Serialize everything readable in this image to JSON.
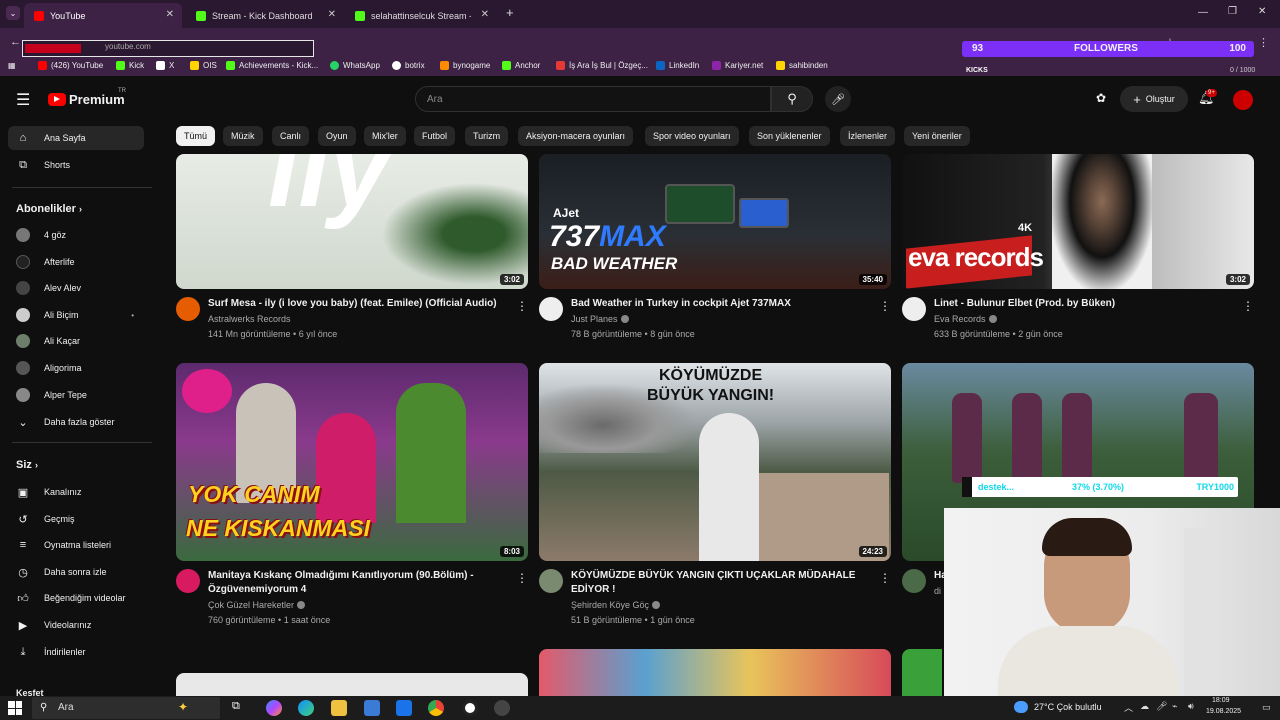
{
  "browser": {
    "tabs": [
      {
        "title": "YouTube",
        "active": true,
        "color": "#ff0000"
      },
      {
        "title": "Stream - Kick Dashboard",
        "active": false,
        "color": "#53fc18"
      },
      {
        "title": "selahattinselcuk Stream - Kick",
        "active": false,
        "color": "#53fc18"
      }
    ],
    "new_tab": "+",
    "url": "youtube.com",
    "bookmarks": [
      {
        "label": "(426) YouTube",
        "color": "#ff0000"
      },
      {
        "label": "Kick",
        "color": "#53fc18"
      },
      {
        "label": "X",
        "color": "#ffffff"
      },
      {
        "label": "OIS",
        "color": "#ffd400"
      },
      {
        "label": "Achievements - Kick...",
        "color": "#53fc18"
      },
      {
        "label": "WhatsApp",
        "color": "#25d366"
      },
      {
        "label": "botrix",
        "color": "#ffffff"
      },
      {
        "label": "bynogame",
        "color": "#ff8a00"
      },
      {
        "label": "Anchor",
        "color": "#53fc18"
      },
      {
        "label": "İş Ara İş Bul | Özgeç...",
        "color": "#e53935"
      },
      {
        "label": "LinkedIn",
        "color": "#0a66c2"
      },
      {
        "label": "Kariyer.net",
        "color": "#8e24aa"
      },
      {
        "label": "sahibinden",
        "color": "#ffd400"
      }
    ]
  },
  "overlay": {
    "followers_count": "93",
    "followers_label": "FOLLOWERS",
    "followers_goal": "100",
    "kicks_label": "KICKS",
    "kicks_progress": "0 / 1000",
    "donate_label": "destek...",
    "donate_percent": "37% (3.70%)",
    "donate_goal": "TRY1000"
  },
  "header": {
    "logo": "Premium",
    "logo_sup": "TR",
    "search_placeholder": "Ara",
    "create_label": "Oluştur",
    "notif_badge": "9+"
  },
  "chips": [
    "Tümü",
    "Müzik",
    "Canlı",
    "Oyun",
    "Mix'ler",
    "Futbol",
    "Turizm",
    "Aksiyon-macera oyunları",
    "Spor video oyunları",
    "Son yüklenenler",
    "İzlenenler",
    "Yeni öneriler"
  ],
  "sidebar": {
    "main": [
      {
        "label": "Ana Sayfa",
        "icon": "home-icon"
      },
      {
        "label": "Shorts",
        "icon": "shorts-icon"
      }
    ],
    "subs_title": "Abonelikler",
    "subs": [
      {
        "label": "4 göz",
        "color": "#777777"
      },
      {
        "label": "Afterlife",
        "color": "#222222"
      },
      {
        "label": "Alev Alev",
        "color": "#444444"
      },
      {
        "label": "Ali Biçim",
        "color": "#cccccc"
      },
      {
        "label": "Ali Kaçar",
        "color": "#6d7f6a"
      },
      {
        "label": "Aligorima",
        "color": "#555555"
      },
      {
        "label": "Alper Tepe",
        "color": "#888888"
      }
    ],
    "more_label": "Daha fazla göster",
    "you_title": "Siz",
    "you": [
      {
        "label": "Kanalınız",
        "icon": "channel-icon"
      },
      {
        "label": "Geçmiş",
        "icon": "history-icon"
      },
      {
        "label": "Oynatma listeleri",
        "icon": "playlist-icon"
      },
      {
        "label": "Daha sonra izle",
        "icon": "watch-later-icon"
      },
      {
        "label": "Beğendiğim videolar",
        "icon": "like-icon"
      },
      {
        "label": "Videolarınız",
        "icon": "your-videos-icon"
      },
      {
        "label": "İndirilenler",
        "icon": "download-icon"
      }
    ],
    "bottom_cut": "Keşfet"
  },
  "videos": [
    {
      "title": "Surf Mesa - ily (i love you baby) (feat. Emilee) (Official Audio)",
      "title2": "",
      "channel": "Astralwerks Records",
      "verified": false,
      "meta": "141 Mn görüntüleme • 6 yıl önce",
      "duration": "3:02",
      "thumb_text": "ily",
      "thumb_sub": ""
    },
    {
      "title": "Bad Weather in Turkey in cockpit Ajet 737MAX",
      "title2": "",
      "channel": "Just Planes",
      "verified": true,
      "meta": "78 B görüntüleme • 8 gün önce",
      "duration": "35:40",
      "thumb_text": "737MAX",
      "thumb_sub": "BAD WEATHER",
      "thumb_brand": "AJet"
    },
    {
      "title": "Linet - Bulunur Elbet (Prod. by Büken)",
      "title2": "",
      "channel": "Eva Records",
      "verified": true,
      "meta": "633 B görüntüleme • 2 gün önce",
      "duration": "3:02",
      "thumb_text": "eva records",
      "thumb_sub": "4K"
    },
    {
      "title": "Manitaya Kıskanç Olmadığımı Kanıtlıyorum (90.Bölüm) -",
      "title2": "Özgüvenemiyorum 4",
      "channel": "Çok Güzel Hareketler",
      "verified": true,
      "meta": "760 görüntüleme • 1 saat önce",
      "duration": "8:03",
      "thumb_text": "YOK CANIM",
      "thumb_sub": "NE KISKANMASI"
    },
    {
      "title": "KÖYÜMÜZDE BÜYÜK YANGIN ÇIKTI UÇAKLAR MÜDAHALE",
      "title2": "EDİYOR !",
      "channel": "Şehirden Köye Göç",
      "verified": true,
      "meta": "51 B görüntüleme • 1 gün önce",
      "duration": "24:23",
      "thumb_text": "KÖYÜMÜZDE",
      "thumb_sub": "BÜYÜK YANGIN!"
    },
    {
      "title": "Ha",
      "title2": "",
      "channel": "di",
      "verified": false,
      "meta": "",
      "duration": "",
      "thumb_text": "",
      "thumb_sub": ""
    }
  ],
  "taskbar": {
    "search": "Ara",
    "weather": "27°C Çok bulutlu",
    "time": "18:09",
    "date": "19.08.2025"
  },
  "colors": {
    "chrome_bg": "#3d2245",
    "youtube_red": "#ff0000",
    "kick_green": "#53fc18",
    "overlay_purple": "#7b2ff7"
  }
}
